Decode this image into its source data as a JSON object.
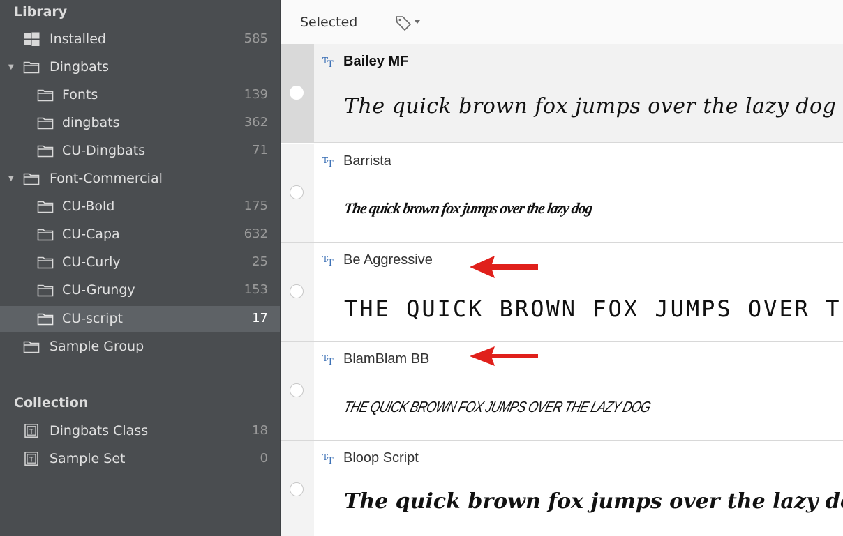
{
  "sidebar": {
    "library_title": "Library",
    "collection_title": "Collection",
    "library_items": [
      {
        "label": "Installed",
        "count": "585",
        "icon": "windows-icon"
      },
      {
        "label": "Dingbats",
        "count": "",
        "icon": "folder-icon",
        "expanded": true
      },
      {
        "label": "Fonts",
        "count": "139",
        "icon": "folder-icon"
      },
      {
        "label": "dingbats",
        "count": "362",
        "icon": "folder-icon"
      },
      {
        "label": "CU-Dingbats",
        "count": "71",
        "icon": "folder-icon"
      },
      {
        "label": "Font-Commercial",
        "count": "",
        "icon": "folder-icon",
        "expanded": true
      },
      {
        "label": "CU-Bold",
        "count": "175",
        "icon": "folder-icon"
      },
      {
        "label": "CU-Capa",
        "count": "632",
        "icon": "folder-icon"
      },
      {
        "label": "CU-Curly",
        "count": "25",
        "icon": "folder-icon"
      },
      {
        "label": "CU-Grungy",
        "count": "153",
        "icon": "folder-icon"
      },
      {
        "label": "CU-script",
        "count": "17",
        "icon": "folder-icon",
        "selected": true
      },
      {
        "label": "Sample Group",
        "count": "",
        "icon": "folder-icon"
      }
    ],
    "collection_items": [
      {
        "label": "Dingbats Class",
        "count": "18",
        "icon": "collection-icon"
      },
      {
        "label": "Sample Set",
        "count": "0",
        "icon": "collection-icon"
      }
    ]
  },
  "toolbar": {
    "selected_label": "Selected",
    "tag_icon": "tag-dropdown-icon"
  },
  "fonts": [
    {
      "name": "Bailey MF",
      "sample": "The quick brown fox jumps over the lazy dog",
      "selected": true
    },
    {
      "name": "Barrista",
      "sample": "The quick brown fox jumps over the lazy dog"
    },
    {
      "name": "Be Aggressive",
      "sample": "THE QUICK BROWN FOX JUMPS OVER THE LAZY DOG"
    },
    {
      "name": "BlamBlam BB",
      "sample": "THE QUICK BROWN FOX JUMPS OVER THE LAZY DOG"
    },
    {
      "name": "Bloop Script",
      "sample": "The quick brown fox jumps over the lazy dog"
    }
  ],
  "colors": {
    "sidebar_bg": "#4a4d50",
    "selected_bg": "#5e6266",
    "annotation_arrow": "#e0201b",
    "tt_icon_blue": "#3a6fb5"
  }
}
